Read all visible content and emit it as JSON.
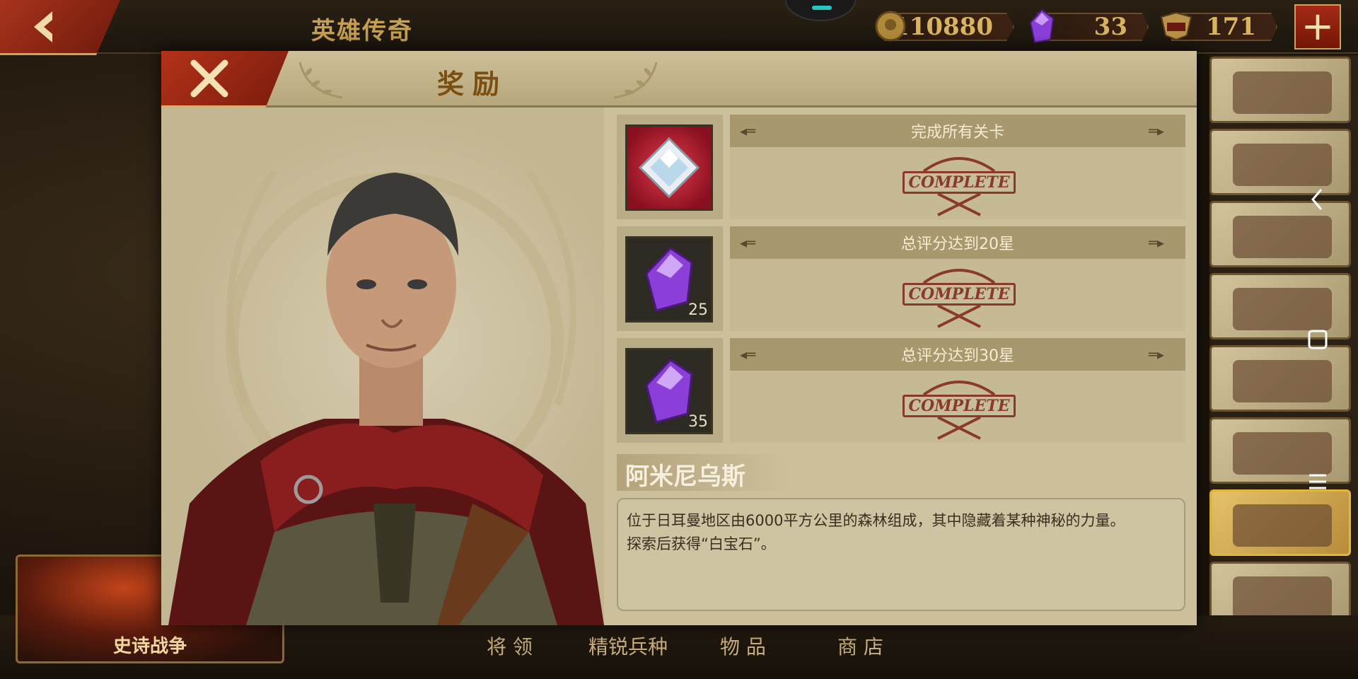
{
  "header": {
    "title": "英雄传奇",
    "resources": {
      "coins": "110880",
      "gems": "33",
      "spqr": "171"
    }
  },
  "modal": {
    "title": "奖励",
    "rewards": [
      {
        "condition": "完成所有关卡",
        "status": "COMPLETE",
        "icon": "white-gemstone-icon",
        "count": ""
      },
      {
        "condition": "总评分达到20星",
        "status": "COMPLETE",
        "icon": "purple-gem-icon",
        "count": "25"
      },
      {
        "condition": "总评分达到30星",
        "status": "COMPLETE",
        "icon": "purple-gem-icon",
        "count": "35"
      }
    ],
    "hero": {
      "name": "阿米尼乌斯",
      "description_line1": "位于日耳曼地区由6000平方公里的森林组成，其中隐藏着某种神秘的力量。",
      "description_line2": "探索后获得“白宝石”。"
    }
  },
  "bottom_nav": {
    "epic_war": "史诗战争",
    "generals": "将 领",
    "elite_troops": "精锐兵种",
    "items": "物 品",
    "shop": "商 店"
  },
  "colors": {
    "accent_red": "#a8331c",
    "gold": "#d8b460",
    "stamp": "#8a3a2a",
    "gem_purple": "#8b3fd8"
  }
}
